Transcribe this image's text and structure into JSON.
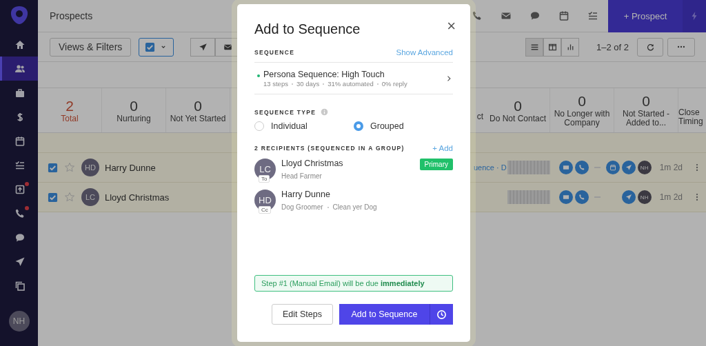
{
  "sidebar": {
    "items": [
      {
        "selected": false,
        "alert": false
      },
      {
        "selected": true,
        "alert": false
      },
      {
        "selected": false,
        "alert": false
      },
      {
        "selected": false,
        "alert": false
      },
      {
        "selected": false,
        "alert": false
      },
      {
        "selected": false,
        "alert": false
      },
      {
        "selected": false,
        "alert": true
      },
      {
        "selected": false,
        "alert": true
      },
      {
        "selected": false,
        "alert": false
      },
      {
        "selected": false,
        "alert": false
      },
      {
        "selected": false,
        "alert": false
      }
    ],
    "avatar": "NH"
  },
  "header": {
    "title": "Prospects",
    "new_button": "+ Prospect"
  },
  "toolbar": {
    "views_button": "Views & Filters",
    "select_all_checked": true,
    "view_modes": [
      {
        "selected": true
      },
      {
        "selected": false
      },
      {
        "selected": false
      }
    ],
    "range": "1–2 of 2"
  },
  "stats_left": [
    {
      "value": "2",
      "label": "Total",
      "selected": true
    },
    {
      "value": "0",
      "label": "Nurturing",
      "selected": false
    },
    {
      "value": "0",
      "label": "Not Yet Started",
      "selected": false
    }
  ],
  "stats_right": [
    {
      "label": "ct",
      "selected": false
    },
    {
      "value": "0",
      "label": "Do Not Contact",
      "selected": false
    },
    {
      "value": "0",
      "label": "No Longer with Company",
      "selected": false
    },
    {
      "value": "0",
      "label": "Not Started - Added to...",
      "selected": false
    },
    {
      "label": "Close Timing",
      "selected": false
    }
  ],
  "prospects": [
    {
      "initials": "HD",
      "name": "Harry Dunne",
      "checked": true,
      "starred": false,
      "sequence": "uence · D",
      "meeting": true,
      "owner": "NH",
      "last_contact": "1m 2d"
    },
    {
      "initials": "LC",
      "name": "Lloyd Christmas",
      "checked": true,
      "starred": false,
      "meeting": false,
      "owner": "NH",
      "last_contact": "1m 2d"
    }
  ],
  "modal": {
    "title": "Add to Sequence",
    "close": "×",
    "sequence_label": "SEQUENCE",
    "advanced_link": "Show Advanced",
    "sequence": {
      "name": "Persona Sequence: High Touch",
      "color": "#1fb573",
      "meta": [
        "13 steps",
        "30 days",
        "31% automated",
        "0% reply"
      ]
    },
    "type_label": "SEQUENCE TYPE",
    "types": [
      {
        "label": "Individual",
        "selected": false
      },
      {
        "label": "Grouped",
        "selected": true
      }
    ],
    "recipients_label": "2 RECIPIENTS (SEQUENCED IN A GROUP)",
    "add_link": "+ Add",
    "recipients": [
      {
        "initials": "LC",
        "role": "To",
        "name": "Lloyd Christmas",
        "details": [
          "Head Farmer"
        ],
        "badge": "Primary"
      },
      {
        "initials": "HD",
        "role": "Cc",
        "name": "Harry Dunne",
        "details": [
          "Dog Groomer",
          "Clean yer Dog"
        ]
      }
    ],
    "notice": "Step #1 (Manual Email) will be due **immediately**",
    "buttons": {
      "edit": "Edit Steps",
      "add": "Add to Sequence"
    }
  }
}
